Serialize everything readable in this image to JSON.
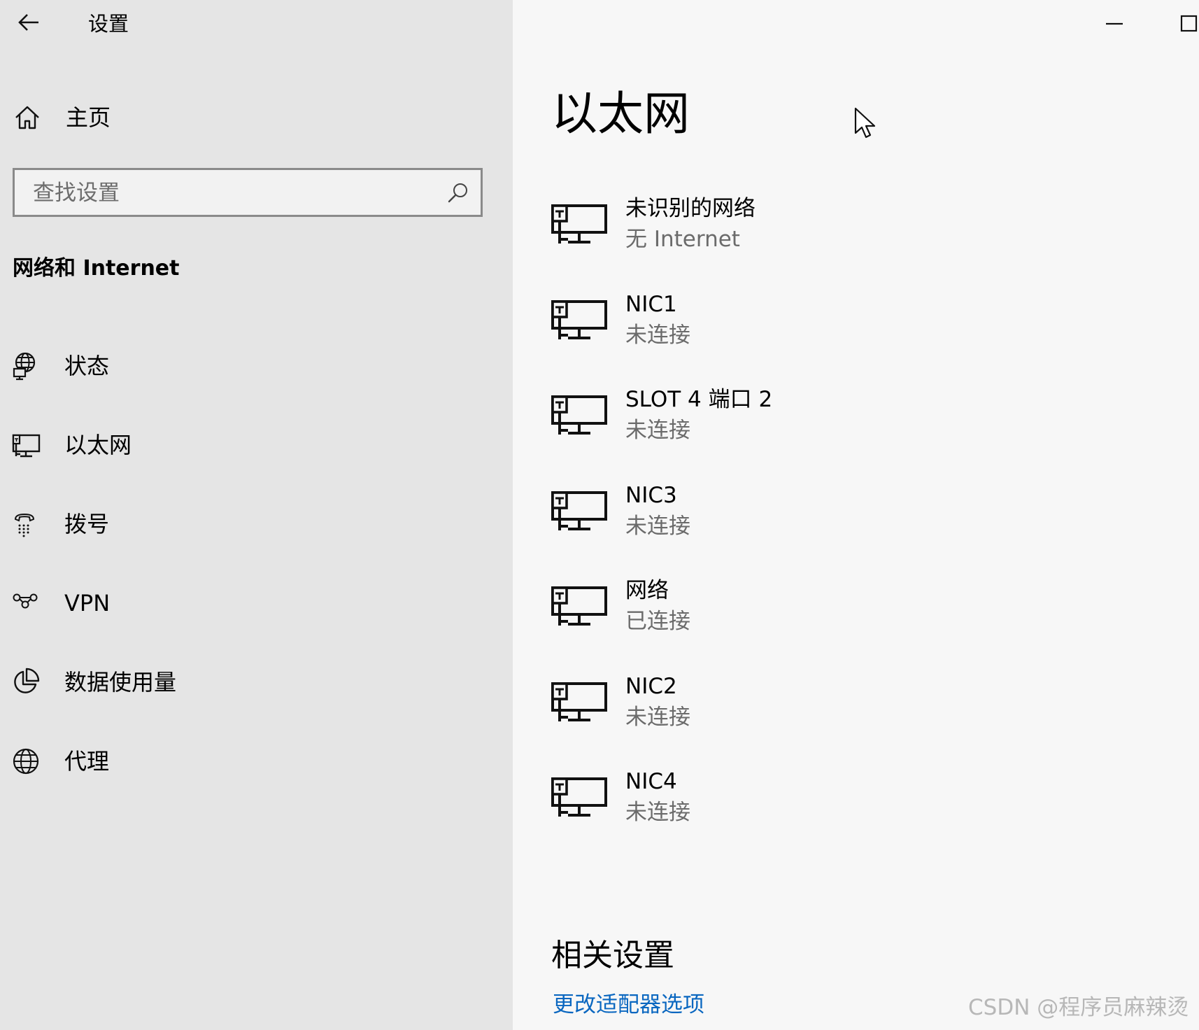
{
  "window": {
    "title": "设置",
    "controls": [
      "minimize-icon",
      "maximize-icon"
    ]
  },
  "sidebar": {
    "home_label": "主页",
    "search": {
      "placeholder": "查找设置",
      "value": ""
    },
    "section_title": "网络和 Internet",
    "items": [
      {
        "label": "状态",
        "icon": "status-globe-icon"
      },
      {
        "label": "以太网",
        "icon": "ethernet-icon"
      },
      {
        "label": "拨号",
        "icon": "dialup-icon"
      },
      {
        "label": "VPN",
        "icon": "vpn-icon"
      },
      {
        "label": "数据使用量",
        "icon": "data-usage-icon"
      },
      {
        "label": "代理",
        "icon": "proxy-globe-icon"
      }
    ]
  },
  "main": {
    "title": "以太网",
    "networks": [
      {
        "name": "未识别的网络",
        "status": "无 Internet"
      },
      {
        "name": "NIC1",
        "status": "未连接"
      },
      {
        "name": "SLOT 4 端口 2",
        "status": "未连接"
      },
      {
        "name": "NIC3",
        "status": "未连接"
      },
      {
        "name": "网络",
        "status": "已连接"
      },
      {
        "name": "NIC2",
        "status": "未连接"
      },
      {
        "name": "NIC4",
        "status": "未连接"
      }
    ],
    "related_settings": {
      "heading": "相关设置",
      "link_label": "更改适配器选项"
    }
  },
  "watermark": "CSDN @程序员麻辣烫",
  "colors": {
    "sidebar_bg": "#e5e5e5",
    "main_bg": "#f7f7f7",
    "link": "#0a67c0",
    "secondary_text": "#6b6b6b"
  }
}
